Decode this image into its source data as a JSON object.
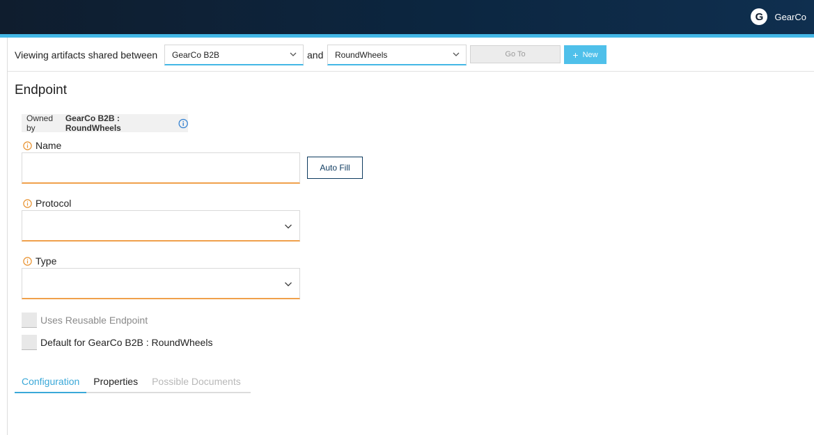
{
  "header": {
    "user_initial": "G",
    "user_name": "GearCo"
  },
  "filter": {
    "label": "Viewing artifacts shared between",
    "partner_a": "GearCo B2B",
    "and_label": "and",
    "partner_b": "RoundWheels",
    "goto_label": "Go To",
    "new_label": "New"
  },
  "page": {
    "title": "Endpoint",
    "owner_prefix": "Owned by",
    "owner_name": "GearCo B2B : RoundWheels"
  },
  "form": {
    "name_label": "Name",
    "name_value": "",
    "autofill_label": "Auto Fill",
    "protocol_label": "Protocol",
    "protocol_value": "",
    "type_label": "Type",
    "type_value": "",
    "reusable_label": "Uses Reusable Endpoint",
    "default_label": "Default for GearCo B2B : RoundWheels"
  },
  "tabs": [
    {
      "label": "Configuration",
      "state": "active"
    },
    {
      "label": "Properties",
      "state": "normal"
    },
    {
      "label": "Possible Documents",
      "state": "disabled"
    }
  ],
  "colors": {
    "accent": "#43b7e6",
    "warning": "#f0a04b",
    "header_bg": "#0f1d2e"
  }
}
